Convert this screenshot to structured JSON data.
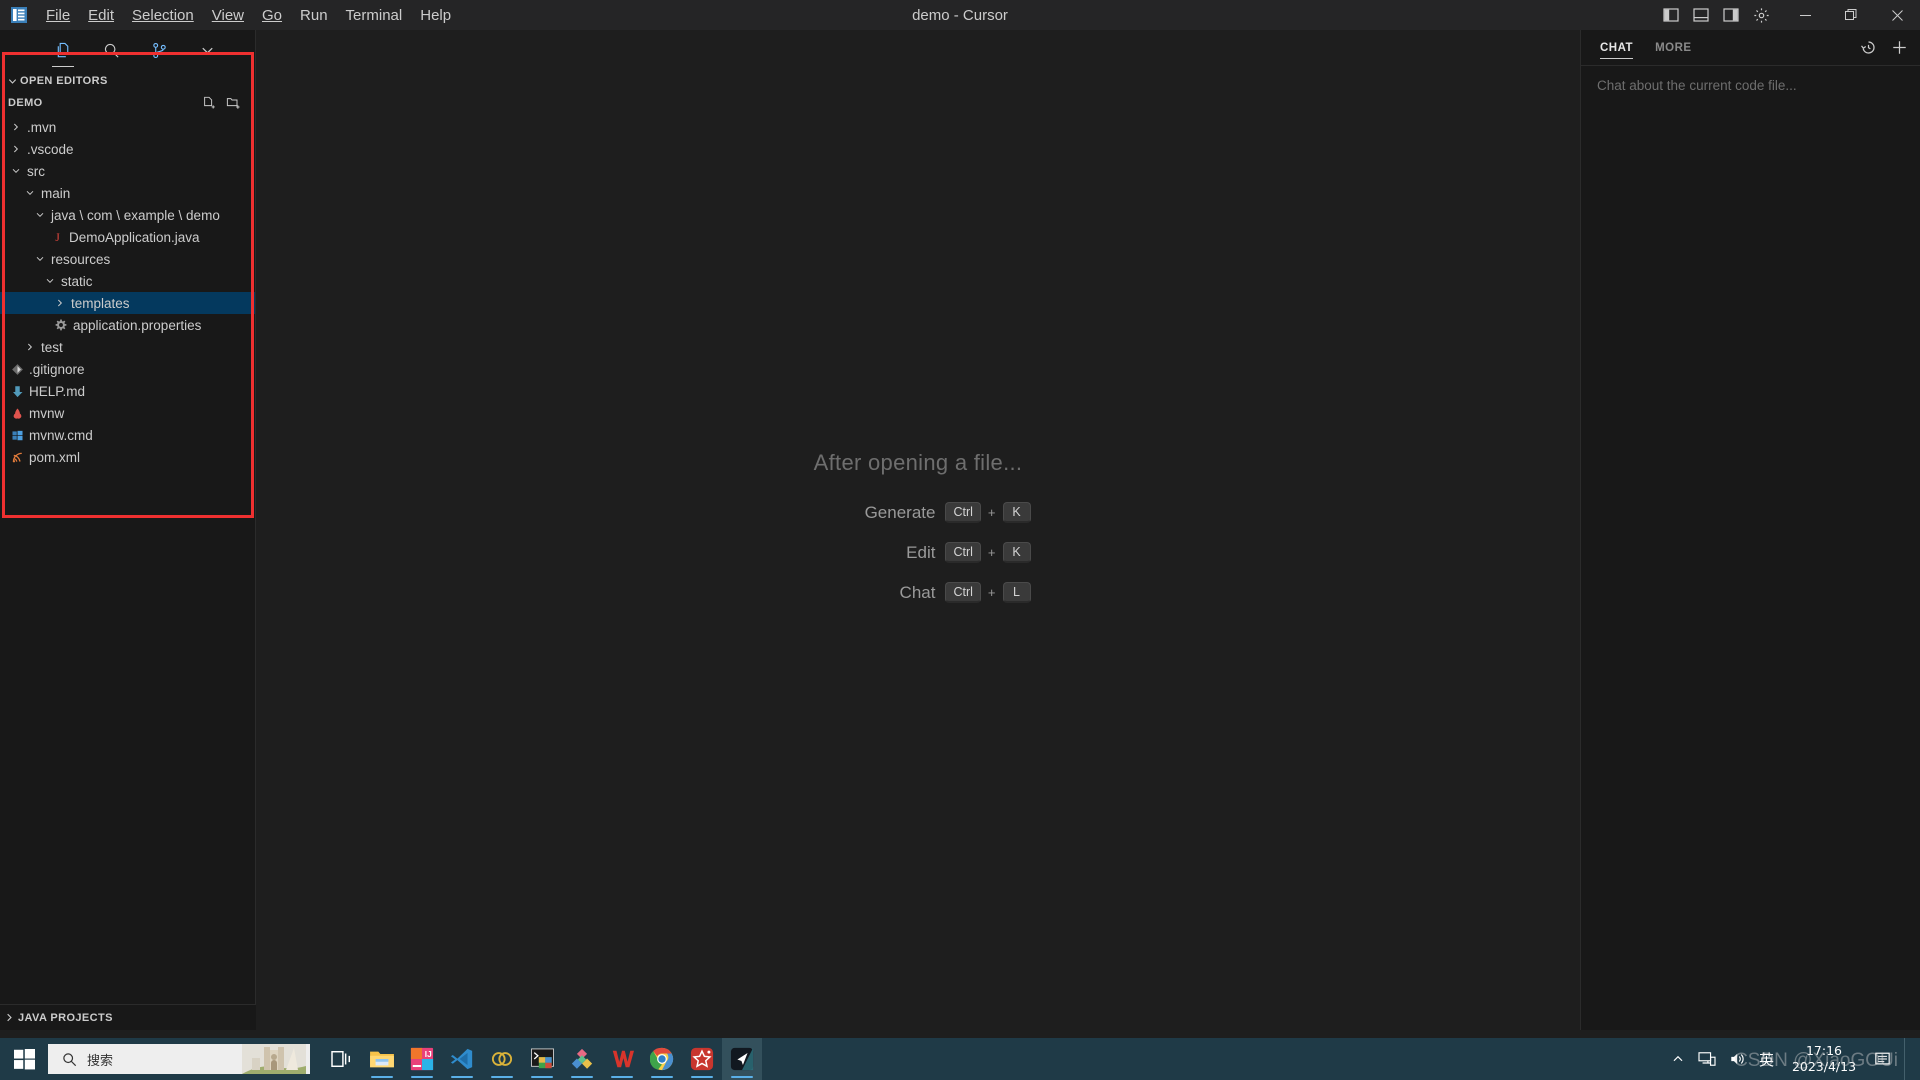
{
  "window": {
    "title": "demo - Cursor",
    "app_icon": "vscode-logo-icon",
    "menus": [
      "File",
      "Edit",
      "Selection",
      "View",
      "Go",
      "Run",
      "Terminal",
      "Help"
    ],
    "layout_buttons": [
      {
        "name": "toggle-primary-sidebar-icon",
        "label": "Toggle Primary Side Bar"
      },
      {
        "name": "toggle-panel-icon",
        "label": "Toggle Panel"
      },
      {
        "name": "toggle-secondary-sidebar-icon",
        "label": "Toggle Secondary Side Bar"
      },
      {
        "name": "settings-gear-icon",
        "label": "Manage"
      }
    ],
    "controls": [
      {
        "name": "minimize-button",
        "glyph": "─"
      },
      {
        "name": "maximize-button",
        "glyph": "❐"
      },
      {
        "name": "close-button",
        "glyph": "✕"
      }
    ]
  },
  "sidebar": {
    "toolbar": [
      {
        "name": "explorer-icon",
        "label": "Explorer",
        "active": true
      },
      {
        "name": "search-icon",
        "label": "Search",
        "active": false
      },
      {
        "name": "source-control-icon",
        "label": "Source Control",
        "active": false
      },
      {
        "name": "chevron-down-icon",
        "label": "More Views",
        "active": false
      }
    ],
    "open_editors_label": "OPEN EDITORS",
    "project_label": "DEMO",
    "project_actions": [
      {
        "name": "new-file-icon",
        "label": "New File"
      },
      {
        "name": "new-folder-icon",
        "label": "New Folder"
      }
    ],
    "bottom_panel_label": "JAVA PROJECTS",
    "tree": [
      {
        "label": ".mvn",
        "indent": 0,
        "type": "folder",
        "state": "collapsed",
        "icon": "folder-icon",
        "selected": false
      },
      {
        "label": ".vscode",
        "indent": 0,
        "type": "folder",
        "state": "collapsed",
        "icon": "folder-icon",
        "selected": false
      },
      {
        "label": "src",
        "indent": 0,
        "type": "folder",
        "state": "expanded",
        "icon": "folder-icon",
        "selected": false
      },
      {
        "label": "main",
        "indent": 1,
        "type": "folder",
        "state": "expanded",
        "icon": "folder-icon",
        "selected": false
      },
      {
        "label": "java \\ com \\ example \\ demo",
        "indent": 2,
        "type": "folder",
        "state": "expanded",
        "icon": "folder-icon",
        "selected": false
      },
      {
        "label": "DemoApplication.java",
        "indent": 3,
        "type": "file",
        "state": "none",
        "icon": "java-file-icon",
        "selected": false
      },
      {
        "label": "resources",
        "indent": 2,
        "type": "folder",
        "state": "expanded",
        "icon": "folder-icon",
        "selected": false
      },
      {
        "label": "static",
        "indent": 3,
        "type": "folder",
        "state": "expanded",
        "icon": "folder-icon",
        "selected": false
      },
      {
        "label": "templates",
        "indent": 4,
        "type": "folder",
        "state": "collapsed",
        "icon": "folder-icon",
        "selected": true
      },
      {
        "label": "application.properties",
        "indent": 4,
        "type": "file",
        "state": "none",
        "icon": "gear-file-icon",
        "selected": false
      },
      {
        "label": "test",
        "indent": 1,
        "type": "folder",
        "state": "collapsed",
        "icon": "folder-icon",
        "selected": false
      },
      {
        "label": ".gitignore",
        "indent": 0,
        "type": "file",
        "state": "none",
        "icon": "git-file-icon",
        "selected": false
      },
      {
        "label": "HELP.md",
        "indent": 0,
        "type": "file",
        "state": "none",
        "icon": "markdown-file-icon",
        "selected": false
      },
      {
        "label": "mvnw",
        "indent": 0,
        "type": "file",
        "state": "none",
        "icon": "maven-file-icon",
        "selected": false
      },
      {
        "label": "mvnw.cmd",
        "indent": 0,
        "type": "file",
        "state": "none",
        "icon": "windows-cmd-file-icon",
        "selected": false
      },
      {
        "label": "pom.xml",
        "indent": 0,
        "type": "file",
        "state": "none",
        "icon": "xml-file-icon",
        "selected": false
      }
    ]
  },
  "editor": {
    "watermark_title": "After opening a file...",
    "shortcuts": [
      {
        "label": "Generate",
        "keys": [
          "Ctrl",
          "K"
        ],
        "separator": "+"
      },
      {
        "label": "Edit",
        "keys": [
          "Ctrl",
          "K"
        ],
        "separator": "+"
      },
      {
        "label": "Chat",
        "keys": [
          "Ctrl",
          "L"
        ],
        "separator": "+"
      }
    ]
  },
  "chat": {
    "tabs": [
      {
        "label": "CHAT",
        "active": true
      },
      {
        "label": "MORE",
        "active": false
      }
    ],
    "actions": [
      {
        "name": "history-icon",
        "label": "History"
      },
      {
        "name": "new-chat-plus-icon",
        "label": "New Chat"
      }
    ],
    "placeholder": "Chat about the current code file..."
  },
  "taskbar": {
    "start_label": "Start",
    "search_placeholder": "搜索",
    "apps": [
      {
        "name": "taskview-icon",
        "label": "Task View",
        "running": false,
        "active": false
      },
      {
        "name": "file-explorer-icon",
        "label": "File Explorer",
        "running": true,
        "active": false
      },
      {
        "name": "intellij-idea-icon",
        "label": "IntelliJ IDEA",
        "running": true,
        "active": false
      },
      {
        "name": "vscode-icon",
        "label": "Visual Studio Code",
        "running": true,
        "active": false
      },
      {
        "name": "navicat-icon",
        "label": "Navicat",
        "running": true,
        "active": false
      },
      {
        "name": "cmd-terminal-icon",
        "label": "Command Prompt",
        "running": true,
        "active": false
      },
      {
        "name": "xmind-icon",
        "label": "XMind",
        "running": true,
        "active": false
      },
      {
        "name": "wps-office-icon",
        "label": "WPS Office",
        "running": true,
        "active": false
      },
      {
        "name": "google-chrome-icon",
        "label": "Google Chrome",
        "running": true,
        "active": false
      },
      {
        "name": "star-app-icon",
        "label": "Star App",
        "running": true,
        "active": false
      },
      {
        "name": "cursor-icon",
        "label": "Cursor",
        "running": true,
        "active": true
      }
    ],
    "tray": {
      "overflow": "show-hidden-icons-icon",
      "network": "network-icon",
      "volume": "volume-icon",
      "ime": "英",
      "notifications": "notification-center-icon"
    },
    "clock": {
      "time": "17:16",
      "date": "2023/4/13"
    }
  },
  "watermark_text": "CSDN @XiaoGOUi",
  "colors": {
    "accent_blue": "#04395e",
    "annotation_red": "#ef3030",
    "titlebar_bg": "#252526",
    "sidebar_bg": "#181818",
    "editor_bg": "#1e1e1e",
    "taskbar_bg": "#1f3a47",
    "text_primary": "#cccccc"
  }
}
